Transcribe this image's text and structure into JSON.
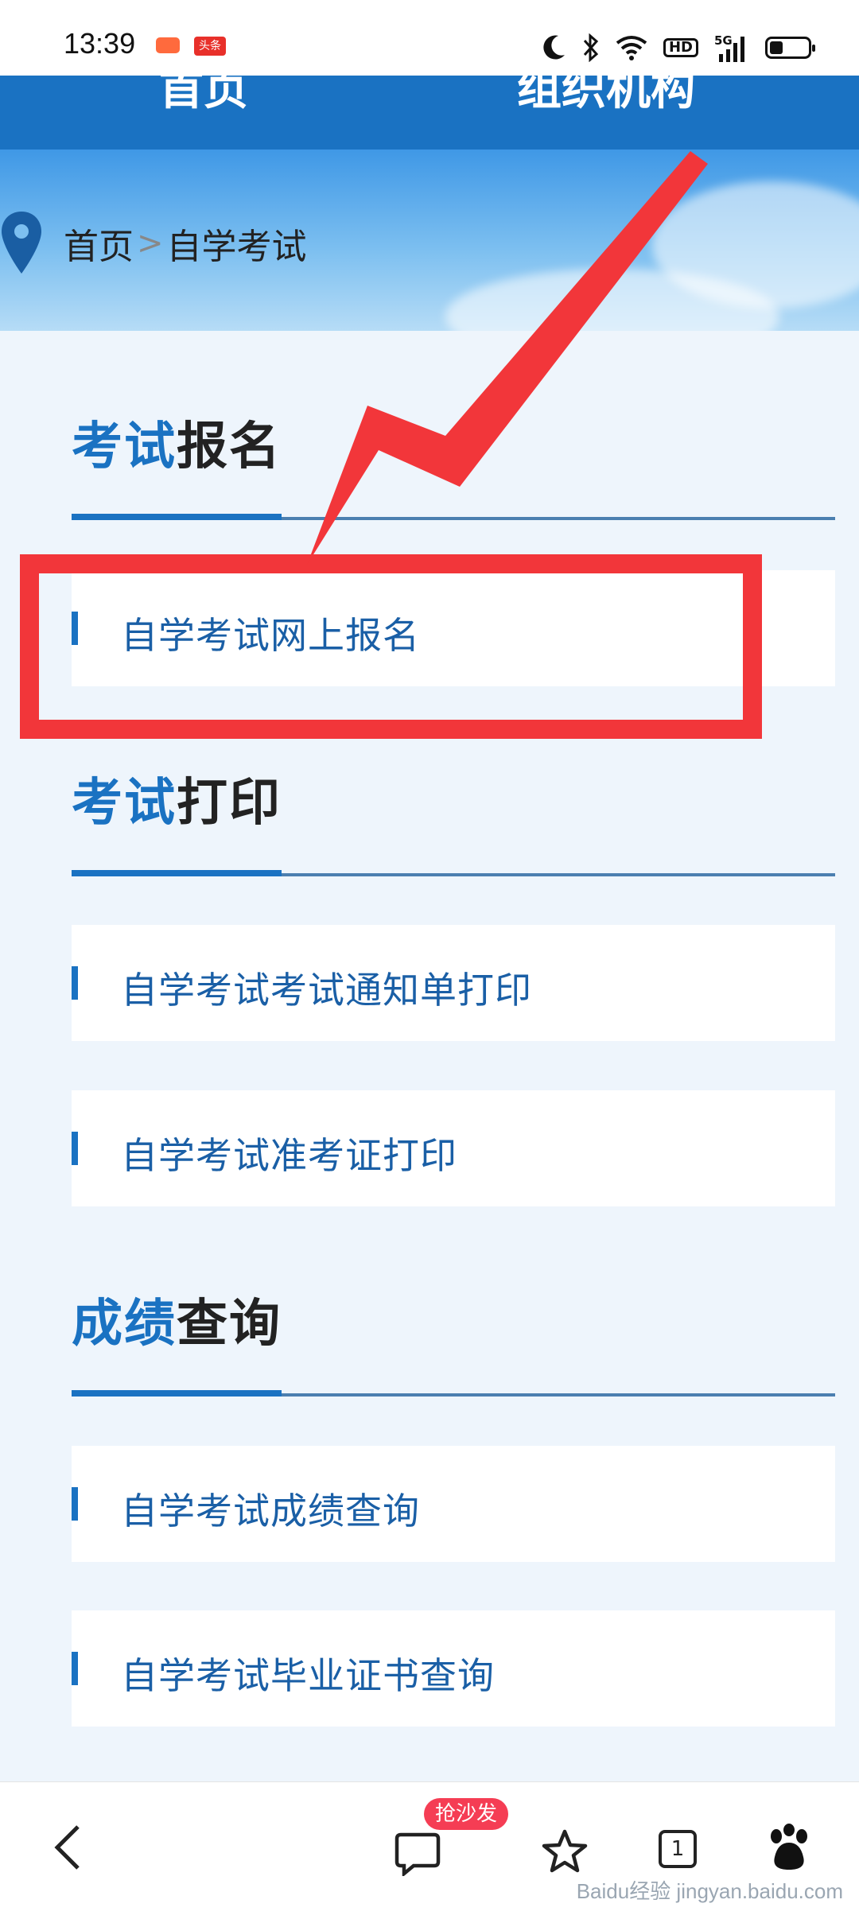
{
  "status_bar": {
    "time": "13:39",
    "news_badge": "头条",
    "icons": [
      "moon-icon",
      "bluetooth-icon",
      "wifi-icon",
      "hd-icon",
      "5g-signal-icon",
      "battery-icon"
    ],
    "hd_label": "HD",
    "network_label": "5G",
    "battery_level": 0.35
  },
  "nav": {
    "items": [
      "首页",
      "组织机构"
    ]
  },
  "banner": {
    "breadcrumb_home": "首页",
    "breadcrumb_separator": ">",
    "breadcrumb_current": "自学考试"
  },
  "sections": [
    {
      "title_accent": "考试",
      "title_rest": "报名",
      "items": [
        "自学考试网上报名"
      ]
    },
    {
      "title_accent": "考试",
      "title_rest": "打印",
      "items": [
        "自学考试考试通知单打印",
        "自学考试准考证打印"
      ]
    },
    {
      "title_accent": "成绩",
      "title_rest": "查询",
      "items": [
        "自学考试成绩查询",
        "自学考试毕业证书查询"
      ]
    }
  ],
  "annotation": {
    "color": "#f2363a"
  },
  "bottom_bar": {
    "comment_badge": "抢沙发",
    "tab_count": "1",
    "icons": [
      "back-icon",
      "comment-icon",
      "star-icon",
      "tabs-icon",
      "baidu-paw-icon"
    ]
  },
  "watermark": "Baidu经验 jingyan.baidu.com",
  "colors": {
    "accent": "#1a72c2",
    "nav_bg": "#1a72c2",
    "page_bg": "#eef5fc",
    "item_text": "#1a5fa6",
    "badge": "#f53d54"
  }
}
